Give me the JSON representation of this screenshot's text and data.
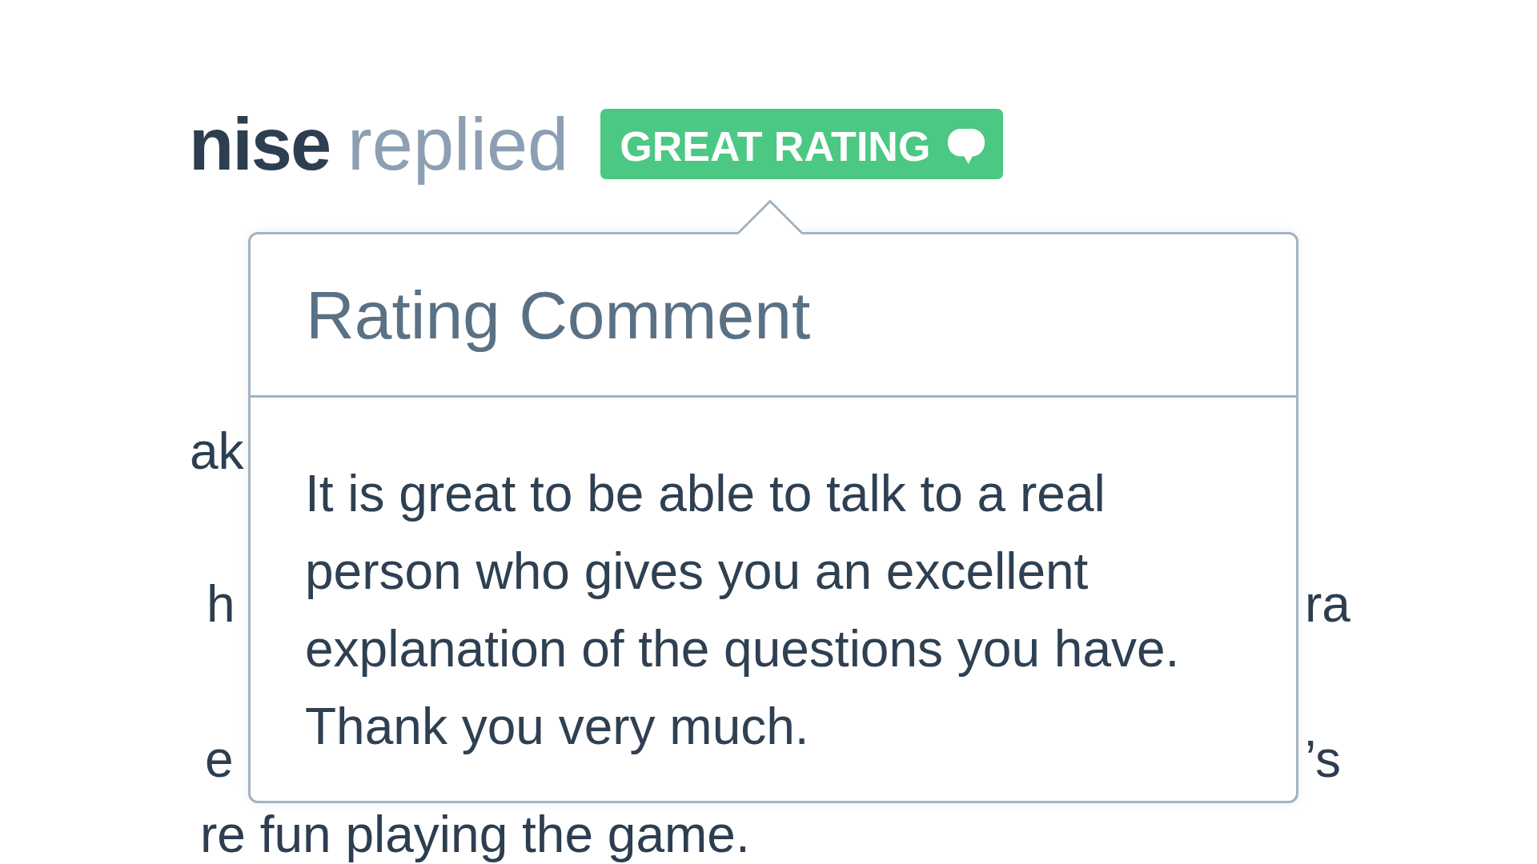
{
  "header": {
    "name": "nise",
    "verb": "replied",
    "badge": {
      "label": "GREAT RATING"
    }
  },
  "background_text": {
    "lines": [
      {
        "left": "ak"
      },
      {
        "left": "h",
        "right": "ra"
      },
      {
        "left": "e",
        "right": "’s"
      },
      {
        "left": "re fun playing the game."
      }
    ]
  },
  "popover": {
    "title": "Rating Comment",
    "body": "It is great to be able to talk to a real person who gives you an excellent explanation of the questions you have. Thank you very much."
  }
}
